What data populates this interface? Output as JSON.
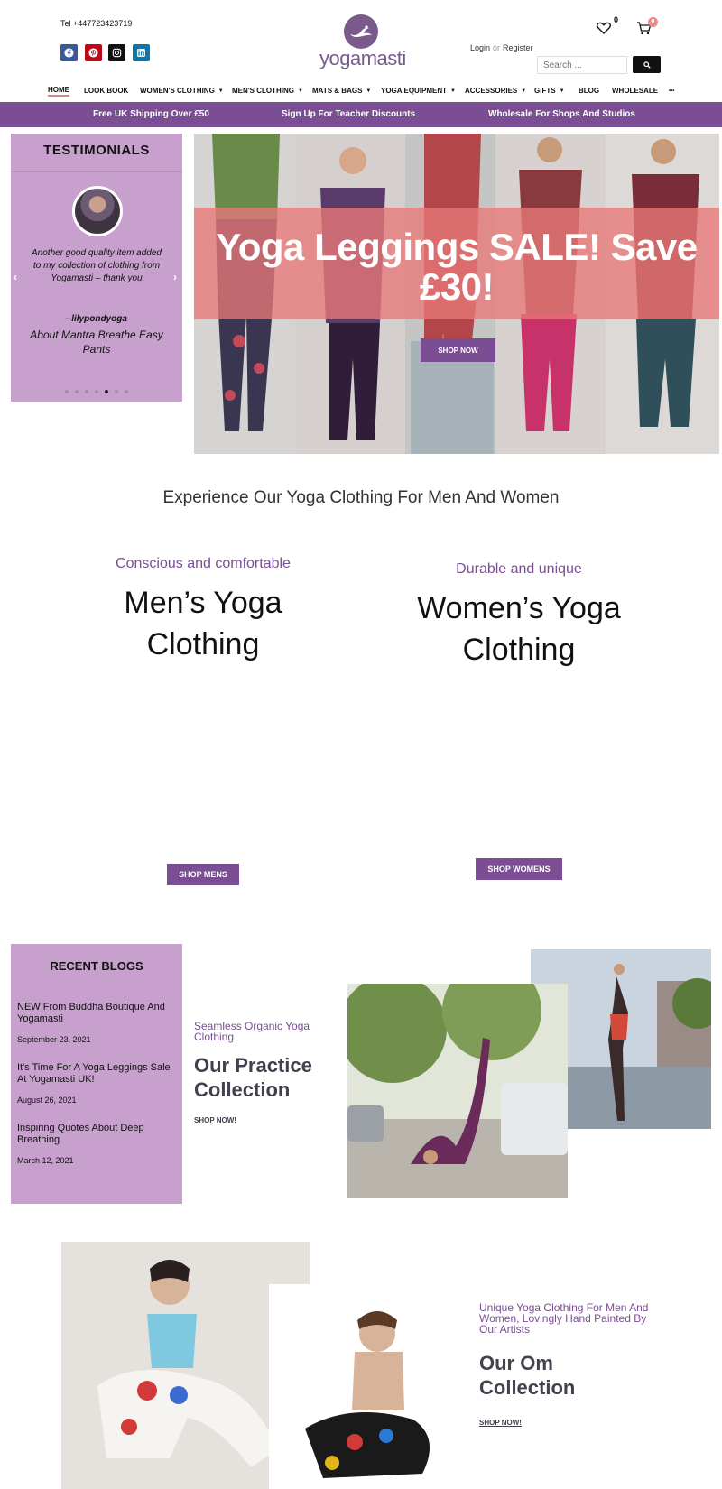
{
  "header": {
    "tel": "Tel +447723423719",
    "logo_text": "yogamasti",
    "login": "Login",
    "or": "or",
    "register": "Register",
    "wishlist_count": "0",
    "cart_count": "0",
    "search_placeholder": "Search ...",
    "social": [
      "facebook-icon",
      "pinterest-icon",
      "instagram-icon",
      "linkedin-icon"
    ]
  },
  "nav": {
    "items": [
      "HOME",
      "LOOK BOOK",
      "WOMEN'S CLOTHING",
      "MEN'S CLOTHING",
      "MATS & BAGS",
      "YOGA EQUIPMENT",
      "ACCESSORIES",
      "GIFTS",
      "BLOG",
      "WHOLESALE",
      "•••"
    ]
  },
  "promo": [
    "Free UK Shipping Over £50",
    "Sign Up For Teacher Discounts",
    "Wholesale For Shops And Studios"
  ],
  "testimonials": {
    "title": "TESTIMONIALS",
    "quote": "Another good quality item added to my collection of clothing from Yogamasti – thank you",
    "author": "- lilypondyoga",
    "about": "About Mantra Breathe Easy Pants"
  },
  "hero": {
    "title": "Yoga Leggings SALE! Save £30!",
    "button": "SHOP NOW"
  },
  "intro": {
    "heading": "Experience Our Yoga Clothing For Men And Women"
  },
  "mens": {
    "subtitle": "Conscious and comfortable",
    "title": "Men’s Yoga Clothing",
    "button": "SHOP MENS"
  },
  "womens": {
    "subtitle": "Durable and unique",
    "title": "Women’s Yoga Clothing",
    "button": "SHOP WOMENS"
  },
  "blogs": {
    "title": "RECENT BLOGS",
    "posts": [
      {
        "title": "NEW From Buddha Boutique And Yogamasti",
        "date": "September 23, 2021"
      },
      {
        "title": "It's Time For A Yoga Leggings Sale At Yogamasti UK!",
        "date": "August 26, 2021"
      },
      {
        "title": "Inspiring Quotes About Deep Breathing",
        "date": "March 12, 2021"
      }
    ]
  },
  "practice": {
    "subtitle": "Seamless Organic Yoga Clothing",
    "title": "Our Practice Collection",
    "link": "SHOP NOW!"
  },
  "om": {
    "subtitle": "Unique Yoga Clothing For Men And Women, Lovingly Hand Painted By Our Artists",
    "title": "Our Om Collection",
    "link": "SHOP NOW!"
  },
  "colors": {
    "brand_purple": "#7a4d94",
    "lilac_panel": "#c7a0cd",
    "sale_band": "#e87878"
  }
}
